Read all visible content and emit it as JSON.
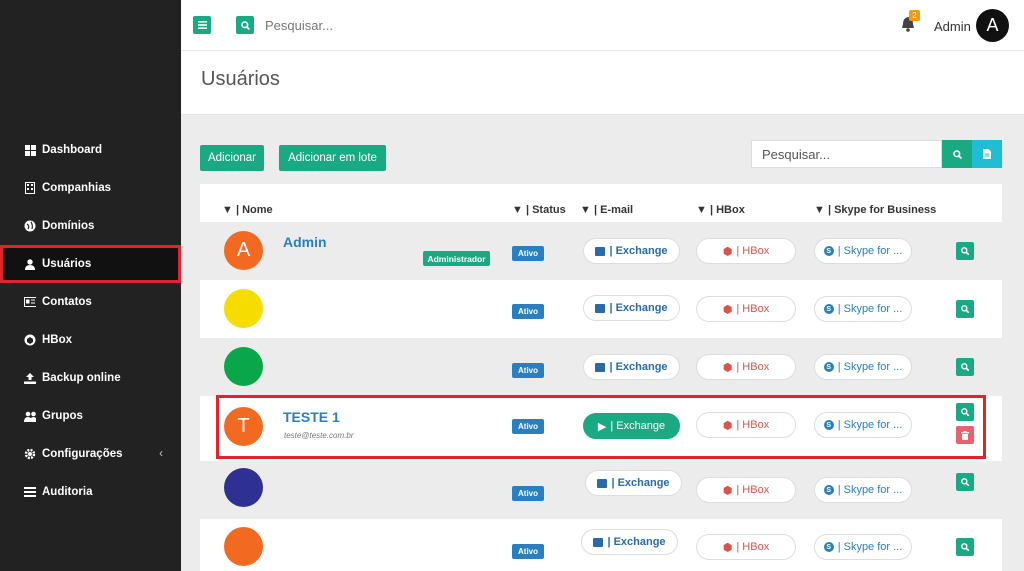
{
  "sidebar": {
    "items": [
      {
        "label": "Dashboard",
        "icon": "grid-icon"
      },
      {
        "label": "Companhias",
        "icon": "building-icon"
      },
      {
        "label": "Domínios",
        "icon": "globe-icon"
      },
      {
        "label": "Usuários",
        "icon": "user-icon",
        "active": true
      },
      {
        "label": "Contatos",
        "icon": "contact-card-icon"
      },
      {
        "label": "HBox",
        "icon": "hbox-icon"
      },
      {
        "label": "Backup online",
        "icon": "upload-icon"
      },
      {
        "label": "Grupos",
        "icon": "users-icon"
      },
      {
        "label": "Configurações",
        "icon": "gear-icon",
        "chevron": "‹"
      },
      {
        "label": "Auditoria",
        "icon": "list-icon"
      }
    ]
  },
  "topbar": {
    "search_placeholder": "Pesquisar...",
    "notification_count": "2",
    "admin_name": "Admin",
    "admin_initial": "A"
  },
  "page": {
    "title": "Usuários"
  },
  "toolbar": {
    "add_label": "Adicionar",
    "bulk_add_label": "Adicionar em lote",
    "search_placeholder": "Pesquisar..."
  },
  "table": {
    "headers": {
      "name": "| Nome",
      "status": "| Status",
      "email": "| E-mail",
      "hbox": "| HBox",
      "skype": "| Skype for Business"
    },
    "rows": [
      {
        "initial": "A",
        "color": "#f26a22",
        "name": "Admin",
        "email": "",
        "role": "Administrador",
        "status": "Ativo",
        "exchange": "| Exchange",
        "hbox": "| HBox",
        "skype": "| Skype for ..."
      },
      {
        "initial": "",
        "color": "#f7dc00",
        "name": "",
        "email": "",
        "role": "",
        "status": "Ativo",
        "exchange": "| Exchange",
        "hbox": "| HBox",
        "skype": "| Skype for ..."
      },
      {
        "initial": "",
        "color": "#0aa64a",
        "name": "",
        "email": "",
        "role": "",
        "status": "Ativo",
        "exchange": "| Exchange",
        "hbox": "| HBox",
        "skype": "| Skype for ..."
      },
      {
        "initial": "T",
        "color": "#f26a22",
        "name": "TESTE 1",
        "email": "teste@teste.com.br",
        "role": "",
        "status": "Ativo",
        "exchange": "| Exchange",
        "hbox": "| HBox",
        "skype": "| Skype for ..."
      },
      {
        "initial": "",
        "color": "#2e3192",
        "name": "",
        "email": "",
        "role": "",
        "status": "Ativo",
        "exchange": "| Exchange",
        "hbox": "| HBox",
        "skype": "| Skype for ..."
      },
      {
        "initial": "",
        "color": "#f26a22",
        "name": "",
        "email": "",
        "role": "",
        "status": "Ativo",
        "exchange": "| Exchange",
        "hbox": "| HBox",
        "skype": "| Skype for ..."
      }
    ]
  },
  "colors": {
    "accent": "#1aaa83",
    "status": "#2a7fc1",
    "highlight": "#e0242b",
    "danger": "#e8616b"
  }
}
